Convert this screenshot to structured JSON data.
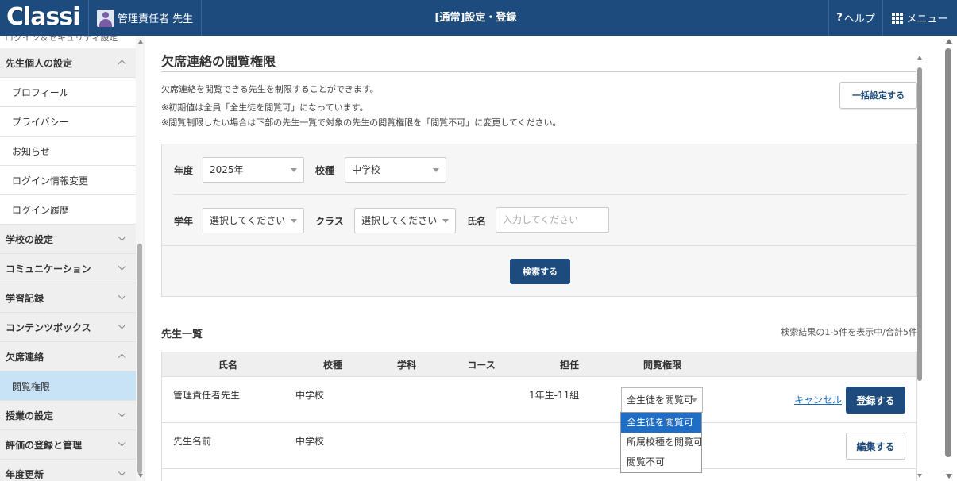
{
  "header": {
    "logo_text": "Classi",
    "user_name": "管理責任者 先生",
    "page_title": "[通常]設定・登録",
    "help_label": "ヘルプ",
    "menu_label": "メニュー",
    "brand_color": "#1d4b7d"
  },
  "sidebar": {
    "cut_off_text": "ログイン＆セキュリティ設定",
    "items": [
      {
        "label": "先生個人の設定",
        "kind": "category",
        "expanded": true
      },
      {
        "label": "プロフィール",
        "kind": "sub"
      },
      {
        "label": "プライバシー",
        "kind": "sub"
      },
      {
        "label": "お知らせ",
        "kind": "sub"
      },
      {
        "label": "ログイン情報変更",
        "kind": "sub"
      },
      {
        "label": "ログイン履歴",
        "kind": "sub"
      },
      {
        "label": "学校の設定",
        "kind": "category",
        "expanded": false
      },
      {
        "label": "コミュニケーション",
        "kind": "category",
        "expanded": false
      },
      {
        "label": "学習記録",
        "kind": "category",
        "expanded": false
      },
      {
        "label": "コンテンツボックス",
        "kind": "category",
        "expanded": false
      },
      {
        "label": "欠席連絡",
        "kind": "category",
        "expanded": true
      },
      {
        "label": "閲覧権限",
        "kind": "active"
      },
      {
        "label": "授業の設定",
        "kind": "category",
        "expanded": false
      },
      {
        "label": "評価の登録と管理",
        "kind": "category",
        "expanded": false
      },
      {
        "label": "年度更新",
        "kind": "category",
        "expanded": false
      }
    ]
  },
  "main": {
    "title": "欠席連絡の閲覧権限",
    "desc1": "欠席連絡を閲覧できる先生を制限することができます。",
    "desc2": "※初期値は全員「全生徒を閲覧可」になっています。",
    "desc3": "※閲覧制限したい場合は下部の先生一覧で対象の先生の閲覧権限を「閲覧不可」に変更してください。",
    "bulk_button": "一括設定する"
  },
  "search": {
    "year_label": "年度",
    "year_value": "2025年",
    "school_type_label": "校種",
    "school_type_value": "中学校",
    "grade_label": "学年",
    "grade_value": "選択してください",
    "class_label": "クラス",
    "class_value": "選択してください",
    "name_label": "氏名",
    "name_placeholder": "入力してください",
    "search_button": "検索する"
  },
  "list": {
    "title": "先生一覧",
    "count_text": "検索結果の1-5件を表示中/合計5件",
    "columns": [
      "氏名",
      "校種",
      "学科",
      "コース",
      "担任",
      "閲覧権限"
    ],
    "rows": [
      {
        "name": "管理責任者先生",
        "school_type": "中学校",
        "department": "",
        "course": "",
        "homeroom": "1年生-11組",
        "permission": "全生徒を閲覧可",
        "editing": true,
        "cancel_label": "キャンセル",
        "register_label": "登録する"
      },
      {
        "name": "先生名前",
        "school_type": "中学校",
        "department": "",
        "course": "",
        "homeroom": "",
        "permission": "",
        "editing": false,
        "edit_label": "編集する"
      }
    ],
    "dropdown_options": [
      "全生徒を閲覧可",
      "所属校種を閲覧可",
      "閲覧不可"
    ],
    "dropdown_selected": "全生徒を閲覧可"
  }
}
